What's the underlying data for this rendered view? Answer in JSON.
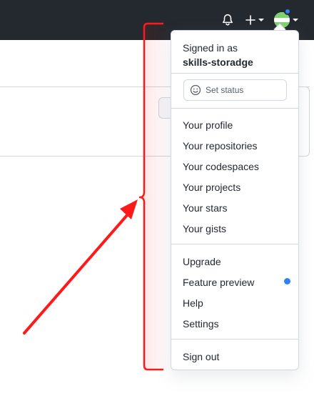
{
  "header": {
    "icons": [
      "bell-icon",
      "plus-icon",
      "chevron-down-icon",
      "avatar"
    ],
    "background_color": "#24292f"
  },
  "menu": {
    "signed_in_label": "Signed in as",
    "username": "skills-storadge",
    "set_status_label": "Set status",
    "items_group1": [
      "Your profile",
      "Your repositories",
      "Your codespaces",
      "Your projects",
      "Your stars",
      "Your gists"
    ],
    "items_group2": [
      "Upgrade",
      "Feature preview",
      "Help",
      "Settings"
    ],
    "sign_out_label": "Sign out",
    "accent_color": "#2f81f7"
  },
  "annotation": {
    "color": "#ff0000",
    "shapes": [
      "bracket",
      "arrow"
    ]
  }
}
